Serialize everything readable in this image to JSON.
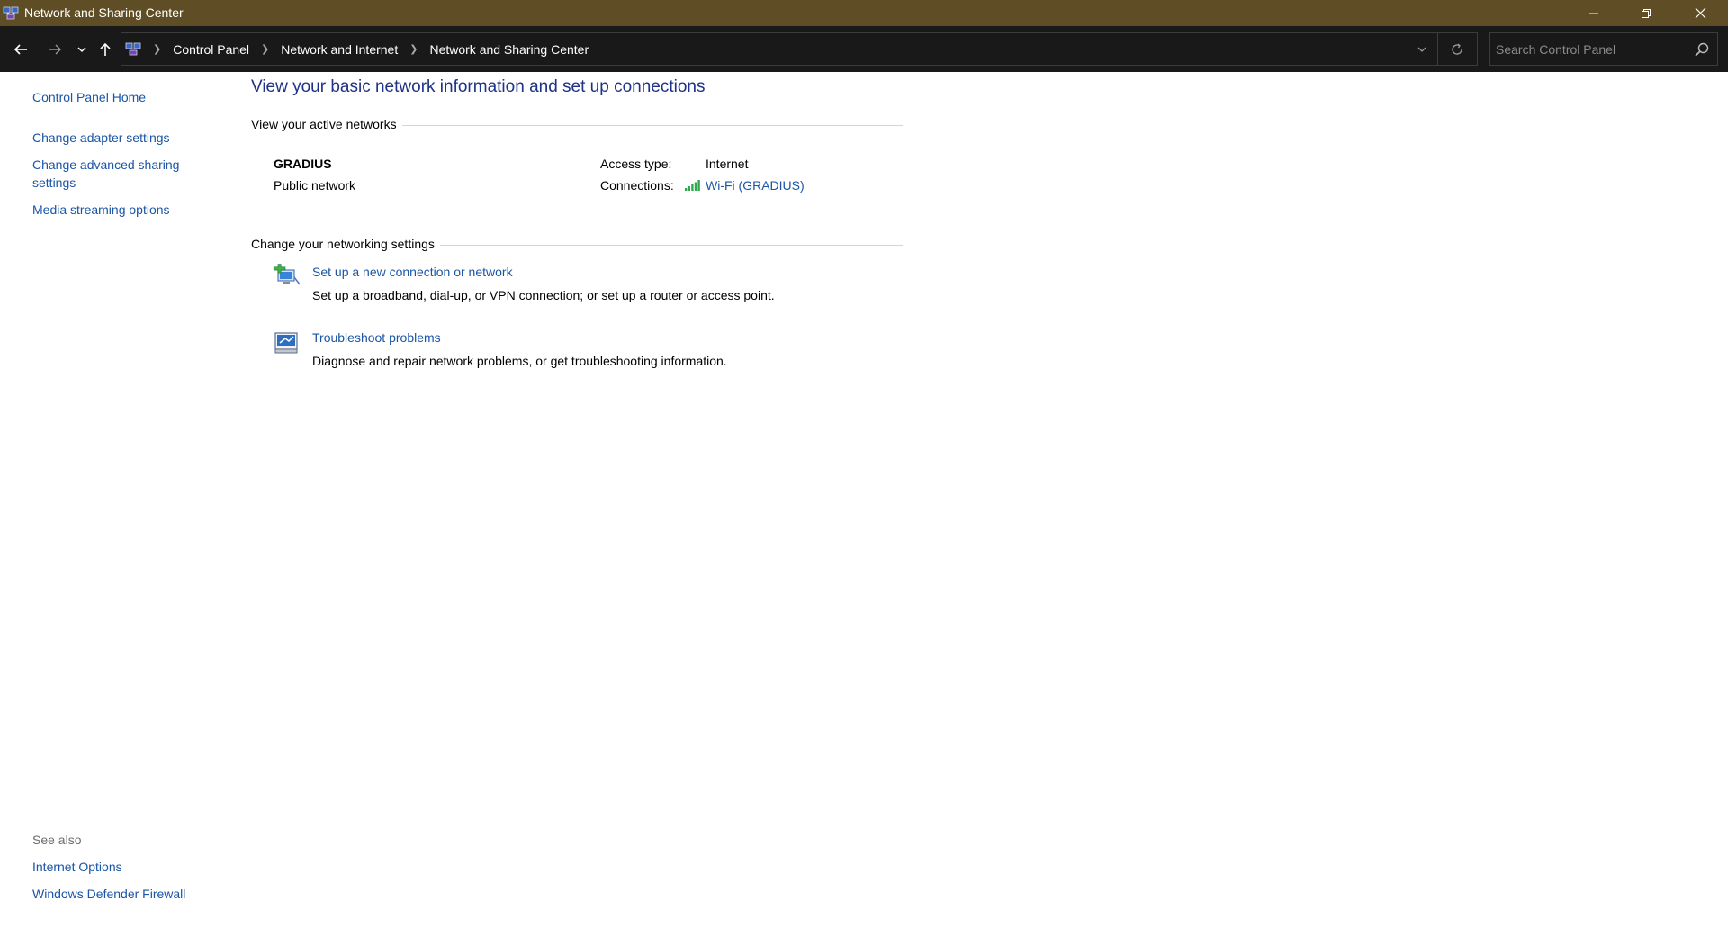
{
  "window": {
    "title": "Network and Sharing Center",
    "app_icon": "network-center-icon",
    "controls": [
      "minimize-icon",
      "restore-icon",
      "close-icon"
    ]
  },
  "navigation": {
    "back_icon": "arrow-left-icon",
    "forward_icon": "arrow-right-icon",
    "recent_icon": "chevron-down-icon",
    "up_icon": "arrow-up-icon",
    "breadcrumbs": [
      "Control Panel",
      "Network and Internet",
      "Network and Sharing Center"
    ],
    "search": {
      "placeholder": "Search Control Panel",
      "value": ""
    }
  },
  "sidebar": {
    "home": "Control Panel Home",
    "tasks": [
      "Change adapter settings",
      "Change advanced sharing settings",
      "Media streaming options"
    ],
    "see_also_heading": "See also",
    "see_also": [
      "Internet Options",
      "Windows Defender Firewall"
    ]
  },
  "main": {
    "title": "View your basic network information and set up connections",
    "active_networks": {
      "heading": "View your active networks",
      "network_name": "GRADIUS",
      "network_type": "Public network",
      "access_type_label": "Access type:",
      "access_type_value": "Internet",
      "connections_label": "Connections:",
      "connection_link": "Wi-Fi (GRADIUS)"
    },
    "settings": {
      "heading": "Change your networking settings",
      "items": [
        {
          "link": "Set up a new connection or network",
          "description": "Set up a broadband, dial-up, or VPN connection; or set up a router or access point.",
          "icon": "new-connection-icon"
        },
        {
          "link": "Troubleshoot problems",
          "description": "Diagnose and repair network problems, or get troubleshooting information.",
          "icon": "troubleshoot-icon"
        }
      ]
    }
  },
  "colors": {
    "titlebar": "#5f4e25",
    "navbar": "#191919",
    "link": "#1a55a6",
    "heading": "#1e3287"
  }
}
